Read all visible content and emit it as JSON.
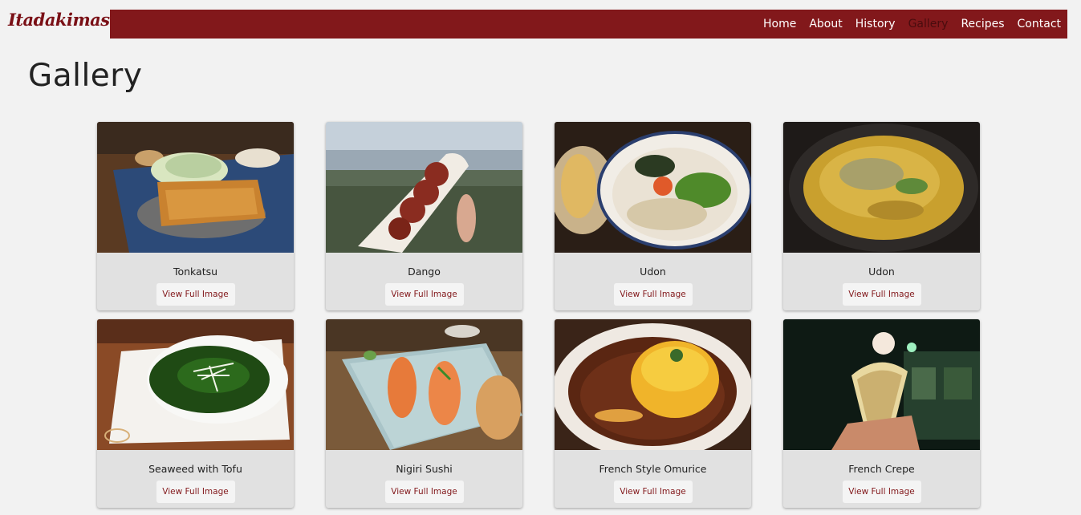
{
  "brand": "Itadakimasu",
  "nav": {
    "home": "Home",
    "about": "About",
    "history": "History",
    "gallery": "Gallery",
    "recipes": "Recipes",
    "contact": "Contact"
  },
  "page_title": "Gallery",
  "button_label": "View Full Image",
  "items": [
    {
      "caption": "Tonkatsu"
    },
    {
      "caption": "Dango"
    },
    {
      "caption": "Udon"
    },
    {
      "caption": "Udon"
    },
    {
      "caption": "Seaweed with Tofu"
    },
    {
      "caption": "Nigiri Sushi"
    },
    {
      "caption": "French Style Omurice"
    },
    {
      "caption": "French Crepe"
    }
  ],
  "colors": {
    "accent": "#82181b",
    "background": "#f2f2f2",
    "card": "#e1e1e1"
  }
}
